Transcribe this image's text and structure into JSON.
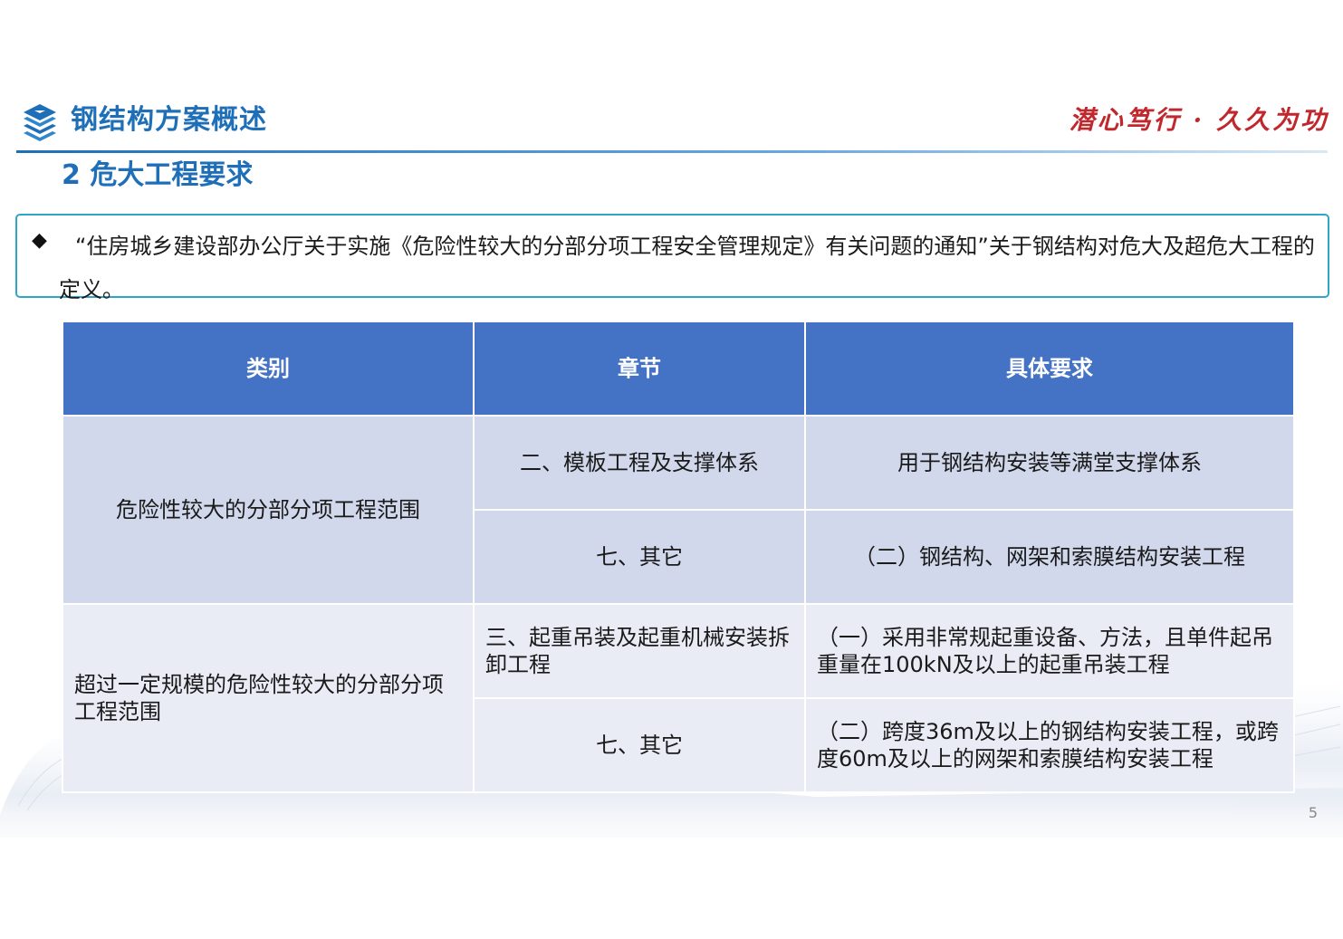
{
  "header": {
    "title": "钢结构方案概述",
    "slogan": "潜心笃行 · 久久为功",
    "logo_icon": "stacked-layers-icon",
    "accent_color": "#1f6fb8",
    "slogan_color": "#c0282d"
  },
  "section": {
    "title": "2  危大工程要求"
  },
  "notice": {
    "bullet": "◆",
    "text": "“住房城乡建设部办公厅关于实施《危险性较大的分部分项工程安全管理规定》有关问题的通知”关于钢结构对危大及超危大工程的定义。",
    "border_color": "#2ea6c8"
  },
  "table": {
    "header_color": "#4472c4",
    "columns": [
      "类别",
      "章节",
      "具体要求"
    ],
    "groups": [
      {
        "category": "危险性较大的分部分项工程范围",
        "rows": [
          {
            "chapter": "二、模板工程及支撑体系",
            "requirement": "用于钢结构安装等满堂支撑体系"
          },
          {
            "chapter": "七、其它",
            "requirement": "（二）钢结构、网架和索膜结构安装工程"
          }
        ]
      },
      {
        "category": "超过一定规模的危险性较大的分部分项工程范围",
        "rows": [
          {
            "chapter": "三、起重吊装及起重机械安装拆卸工程",
            "requirement": "（一）采用非常规起重设备、方法，且单件起吊重量在100kN及以上的起重吊装工程"
          },
          {
            "chapter": "七、其它",
            "requirement": "（二）跨度36m及以上的钢结构安装工程，或跨度60m及以上的网架和索膜结构安装工程"
          }
        ]
      }
    ]
  },
  "footer": {
    "page_number": "5"
  }
}
